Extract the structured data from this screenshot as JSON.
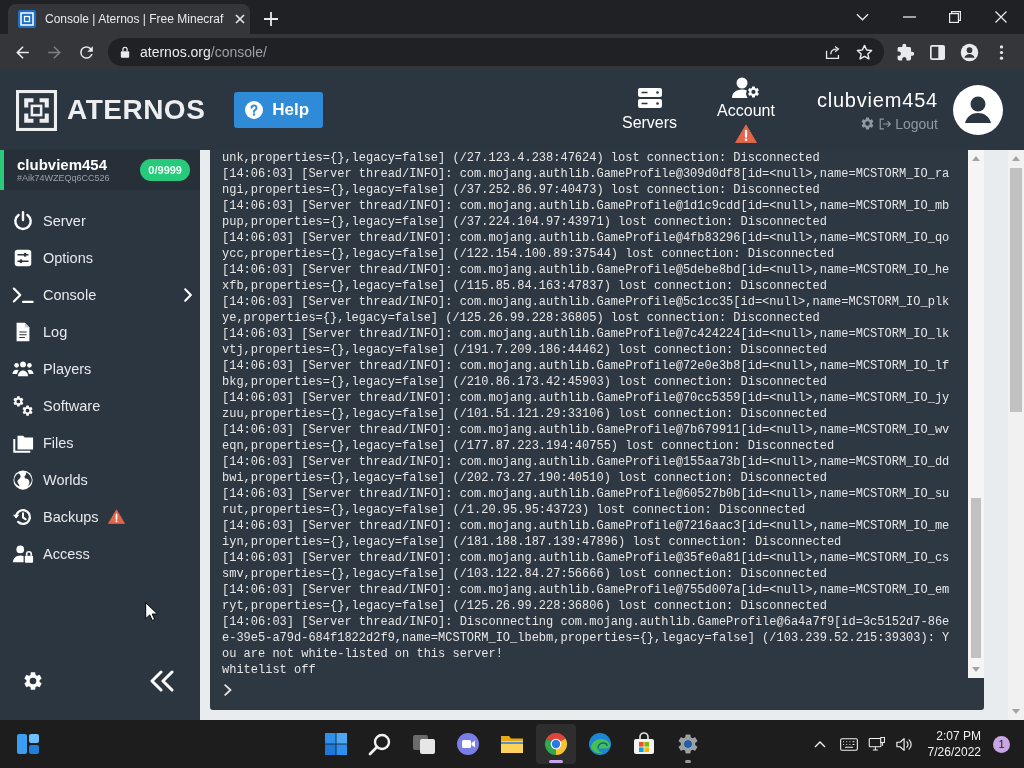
{
  "browser": {
    "tab": {
      "title": "Console | Aternos | Free Minecraf"
    },
    "nav_buttons": [
      {
        "kind": "back",
        "disabled": false
      },
      {
        "kind": "forward",
        "disabled": true
      },
      {
        "kind": "reload",
        "disabled": false
      }
    ],
    "address": {
      "host": "aternos.org",
      "path": "/console/"
    }
  },
  "header": {
    "brand": "ATERNOS",
    "help": "Help",
    "nav": [
      {
        "kind": "servers",
        "label": "Servers",
        "warning": false
      },
      {
        "kind": "account",
        "label": "Account",
        "warning": true
      }
    ],
    "user": {
      "name": "clubviem454",
      "logout": "Logout"
    }
  },
  "sidebar": {
    "server": {
      "name": "clubviem454",
      "id": "#Aik74WZEQq6CC526",
      "players": "0/9999"
    },
    "menu": [
      {
        "kind": "server",
        "label": "Server",
        "selected": false,
        "warning": false
      },
      {
        "kind": "options",
        "label": "Options",
        "selected": false,
        "warning": false
      },
      {
        "kind": "console",
        "label": "Console",
        "selected": true,
        "warning": false
      },
      {
        "kind": "log",
        "label": "Log",
        "selected": false,
        "warning": false
      },
      {
        "kind": "players",
        "label": "Players",
        "selected": false,
        "warning": false
      },
      {
        "kind": "software",
        "label": "Software",
        "selected": false,
        "warning": false
      },
      {
        "kind": "files",
        "label": "Files",
        "selected": false,
        "warning": false
      },
      {
        "kind": "worlds",
        "label": "Worlds",
        "selected": false,
        "warning": false
      },
      {
        "kind": "backups",
        "label": "Backups",
        "selected": false,
        "warning": true
      },
      {
        "kind": "access",
        "label": "Access",
        "selected": false,
        "warning": false
      }
    ]
  },
  "console": {
    "lines": [
      "unk,properties={},legacy=false] (/27.123.4.238:47624) lost connection: Disconnected",
      "[14:06:03] [Server thread/INFO]: com.mojang.authlib.GameProfile@309d0df8[id=<null>,name=MCSTORM_IO_rangi,properties={},legacy=false] (/37.252.86.97:40473) lost connection: Disconnected",
      "[14:06:03] [Server thread/INFO]: com.mojang.authlib.GameProfile@1d1c9cdd[id=<null>,name=MCSTORM_IO_mbpup,properties={},legacy=false] (/37.224.104.97:43971) lost connection: Disconnected",
      "[14:06:03] [Server thread/INFO]: com.mojang.authlib.GameProfile@4fb83296[id=<null>,name=MCSTORM_IO_qoycc,properties={},legacy=false] (/122.154.100.89:37544) lost connection: Disconnected",
      "[14:06:03] [Server thread/INFO]: com.mojang.authlib.GameProfile@5debe8bd[id=<null>,name=MCSTORM_IO_hexfb,properties={},legacy=false] (/115.85.84.163:47837) lost connection: Disconnected",
      "[14:06:03] [Server thread/INFO]: com.mojang.authlib.GameProfile@5c1cc35[id=<null>,name=MCSTORM_IO_plkye,properties={},legacy=false] (/125.26.99.228:36805) lost connection: Disconnected",
      "[14:06:03] [Server thread/INFO]: com.mojang.authlib.GameProfile@7c424224[id=<null>,name=MCSTORM_IO_lkvtj,properties={},legacy=false] (/191.7.209.186:44462) lost connection: Disconnected",
      "[14:06:03] [Server thread/INFO]: com.mojang.authlib.GameProfile@72e0e3b8[id=<null>,name=MCSTORM_IO_lfbkg,properties={},legacy=false] (/210.86.173.42:45903) lost connection: Disconnected",
      "[14:06:03] [Server thread/INFO]: com.mojang.authlib.GameProfile@70cc5359[id=<null>,name=MCSTORM_IO_jyzuu,properties={},legacy=false] (/101.51.121.29:33106) lost connection: Disconnected",
      "[14:06:03] [Server thread/INFO]: com.mojang.authlib.GameProfile@7b679911[id=<null>,name=MCSTORM_IO_wveqn,properties={},legacy=false] (/177.87.223.194:40755) lost connection: Disconnected",
      "[14:06:03] [Server thread/INFO]: com.mojang.authlib.GameProfile@155aa73b[id=<null>,name=MCSTORM_IO_ddbwi,properties={},legacy=false] (/202.73.27.190:40510) lost connection: Disconnected",
      "[14:06:03] [Server thread/INFO]: com.mojang.authlib.GameProfile@60527b0b[id=<null>,name=MCSTORM_IO_surut,properties={},legacy=false] (/1.20.95.95:43723) lost connection: Disconnected",
      "[14:06:03] [Server thread/INFO]: com.mojang.authlib.GameProfile@7216aac3[id=<null>,name=MCSTORM_IO_meiyn,properties={},legacy=false] (/181.188.187.139:47896) lost connection: Disconnected",
      "[14:06:03] [Server thread/INFO]: com.mojang.authlib.GameProfile@35fe0a81[id=<null>,name=MCSTORM_IO_cssmv,properties={},legacy=false] (/103.122.84.27:56666) lost connection: Disconnected",
      "[14:06:03] [Server thread/INFO]: com.mojang.authlib.GameProfile@755d007a[id=<null>,name=MCSTORM_IO_emryt,properties={},legacy=false] (/125.26.99.228:36806) lost connection: Disconnected",
      "[14:06:03] [Server thread/INFO]: Disconnecting com.mojang.authlib.GameProfile@6a4a7f9[id=3c5152d7-86ee-39e5-a79d-684f1822d2f9,name=MCSTORM_IO_lbebm,properties={},legacy=false] (/103.239.52.215:39303): You are not white-listed on this server!",
      "whitelist off"
    ]
  },
  "taskbar": {
    "apps": [
      {
        "kind": "start",
        "running": false,
        "active": false
      },
      {
        "kind": "search",
        "running": false,
        "active": false
      },
      {
        "kind": "taskview",
        "running": false,
        "active": false
      },
      {
        "kind": "chat",
        "running": false,
        "active": false
      },
      {
        "kind": "folder",
        "running": false,
        "active": false
      },
      {
        "kind": "chrome",
        "running": true,
        "active": true
      },
      {
        "kind": "edge",
        "running": false,
        "active": false
      },
      {
        "kind": "store",
        "running": false,
        "active": false
      },
      {
        "kind": "settings",
        "running": true,
        "active": false
      }
    ],
    "clock": {
      "time": "2:07 PM",
      "date": "7/26/2022"
    },
    "notifications": "1"
  }
}
